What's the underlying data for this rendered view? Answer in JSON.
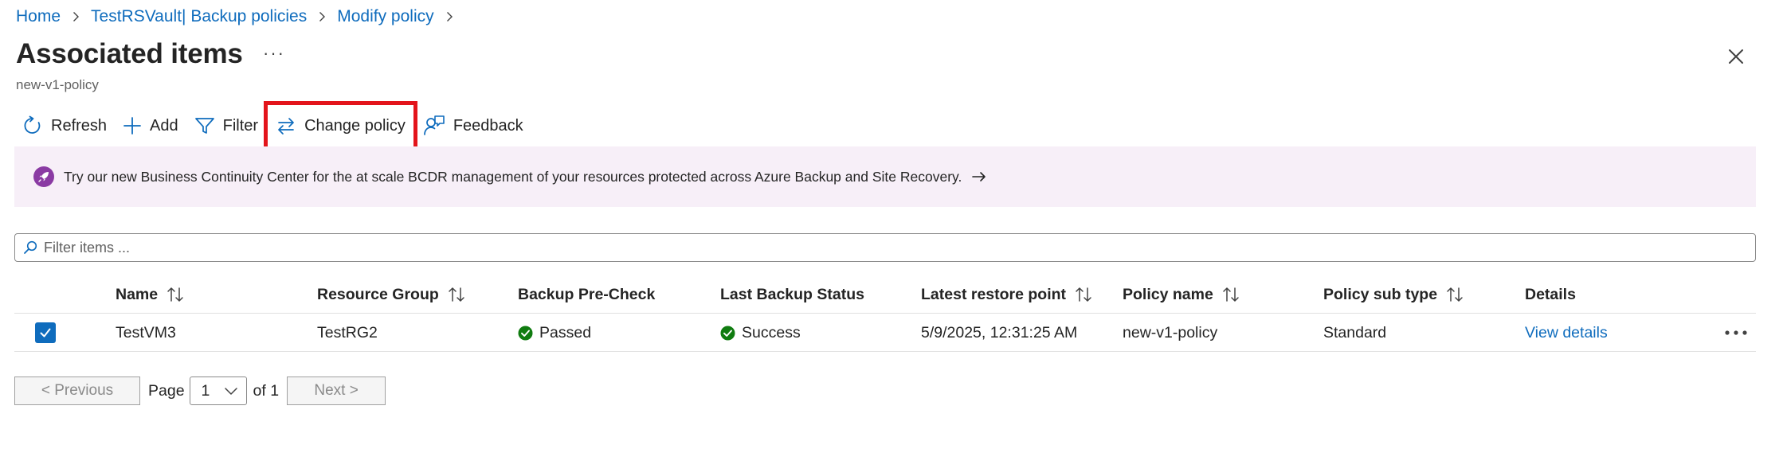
{
  "breadcrumb": [
    {
      "label": "Home"
    },
    {
      "label": "TestRSVault| Backup policies"
    },
    {
      "label": "Modify policy"
    }
  ],
  "header": {
    "title": "Associated items",
    "subtitle": "new-v1-policy",
    "more_label": "···"
  },
  "toolbar": {
    "refresh": "Refresh",
    "add": "Add",
    "filter": "Filter",
    "change_policy": "Change policy",
    "feedback": "Feedback"
  },
  "banner": {
    "text": "Try our new Business Continuity Center for the at scale BCDR management of your resources protected across Azure Backup and Site Recovery."
  },
  "search": {
    "placeholder": "Filter items ..."
  },
  "table": {
    "columns": [
      "Name",
      "Resource Group",
      "Backup Pre-Check",
      "Last Backup Status",
      "Latest restore point",
      "Policy name",
      "Policy sub type",
      "Details"
    ],
    "rows": [
      {
        "selected": true,
        "name": "TestVM3",
        "resource_group": "TestRG2",
        "backup_precheck": "Passed",
        "last_backup_status": "Success",
        "latest_restore_point": "5/9/2025, 12:31:25 AM",
        "policy_name": "new-v1-policy",
        "policy_sub_type": "Standard",
        "details": "View details"
      }
    ]
  },
  "pagination": {
    "previous": "< Previous",
    "page_label": "Page",
    "current_page": "1",
    "of_label": "of 1",
    "next": "Next >"
  },
  "colors": {
    "accent": "#0f6cbd",
    "highlight": "#e3141b",
    "success": "#107c10",
    "banner_bg": "#f7eff8",
    "banner_icon": "#8a3aa3"
  }
}
